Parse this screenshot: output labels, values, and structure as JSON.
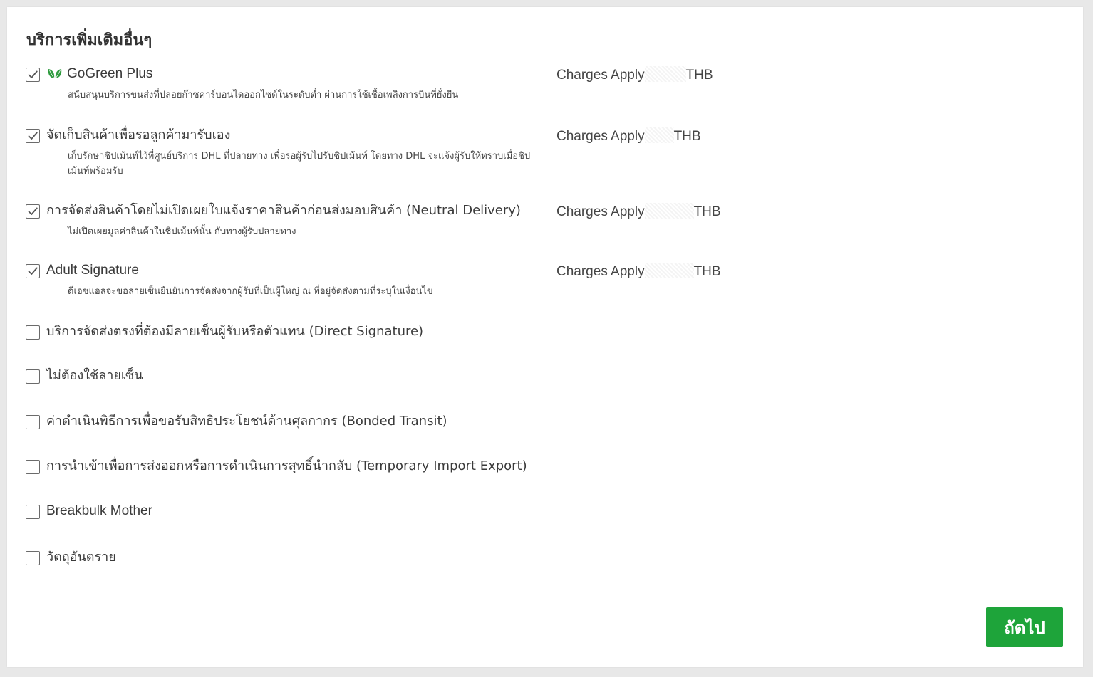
{
  "section": {
    "title": "บริการเพิ่มเติมอื่นๆ"
  },
  "services": [
    {
      "label": "GoGreen Plus",
      "checked": true,
      "icon": "leaf-icon",
      "description": "สนับสนุนบริการขนส่งที่ปล่อยก๊าซคาร์บอนไดออกไซด์ในระดับต่ำ ผ่านการใช้เชื้อเพลิงการบินที่ยั่งยืน",
      "charges": "Charges Apply",
      "currency": "THB"
    },
    {
      "label": "จัดเก็บสินค้าเพื่อรอลูกค้ามารับเอง",
      "checked": true,
      "description": "เก็บรักษาชิปเม้นท์ไว้ที่ศูนย์บริการ DHL ที่ปลายทาง เพื่อรอผู้รับไปรับชิปเม้นท์ โดยทาง DHL จะแจ้งผู้รับให้ทราบเมื่อชิปเม้นท์พร้อมรับ",
      "charges": "Charges Apply",
      "currency": "THB"
    },
    {
      "label": "การจัดส่งสินค้าโดยไม่เปิดเผยใบแจ้งราคาสินค้าก่อนส่งมอบสินค้า (Neutral Delivery)",
      "checked": true,
      "description": "ไม่เปิดเผยมูลค่าสินค้าในชิปเม้นท์นั้น กับทางผู้รับปลายทาง",
      "charges": "Charges Apply",
      "currency": "THB"
    },
    {
      "label": "Adult Signature",
      "checked": true,
      "description": "ดีเอชแอลจะขอลายเซ็นยืนยันการจัดส่งจากผู้รับที่เป็นผู้ใหญ่ ณ ที่อยู่จัดส่งตามที่ระบุในเงื่อนไข",
      "charges": "Charges Apply",
      "currency": "THB"
    },
    {
      "label": "บริการจัดส่งตรงที่ต้องมีลายเซ็นผู้รับหรือตัวแทน (Direct Signature)",
      "checked": false
    },
    {
      "label": "ไม่ต้องใช้ลายเซ็น",
      "checked": false
    },
    {
      "label": "ค่าดำเนินพิธีการเพื่อขอรับสิทธิประโยชน์ด้านศุลกากร (Bonded Transit)",
      "checked": false
    },
    {
      "label": "การนำเข้าเพื่อการส่งออกหรือการดำเนินการสุทธิ์นำกลับ (Temporary Import Export)",
      "checked": false
    },
    {
      "label": "Breakbulk Mother",
      "checked": false
    },
    {
      "label": "วัตถุอันตราย",
      "checked": false
    }
  ],
  "actions": {
    "next_label": "ถัดไป"
  },
  "colors": {
    "accent_green": "#1ea43a",
    "leaf_green": "#2e9b3e",
    "checkbox_border": "#6b6b6b"
  }
}
